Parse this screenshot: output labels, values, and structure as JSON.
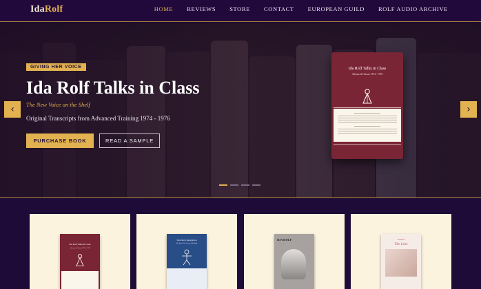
{
  "brand": {
    "first": "Ida",
    "second": "Rolf"
  },
  "nav": [
    {
      "label": "HOME",
      "active": true
    },
    {
      "label": "REVIEWS"
    },
    {
      "label": "STORE"
    },
    {
      "label": "CONTACT"
    },
    {
      "label": "EUROPEAN GUILD"
    },
    {
      "label": "ROLF AUDIO ARCHIVE"
    }
  ],
  "hero": {
    "badge": "GIVING HER VOICE",
    "title": "Ida Rolf Talks in Class",
    "subtitle": "The New Voice on the Shelf",
    "description": "Original Transcripts from Advanced Training 1974 - 1976",
    "primary_button": "PURCHASE BOOK",
    "secondary_button": "READ A SAMPLE",
    "prev_arrow": "‹",
    "next_arrow": "›",
    "book": {
      "title": "Ida Rolf Talks in Class",
      "subtitle": "Advanced Classes 1974 - 1976",
      "cover_color": "#7a2535"
    },
    "slide_count": 4,
    "active_slide": 1
  },
  "cards": [
    {
      "cover_title": "Ida Rolf Talks in Class",
      "cover_subtitle": "Advanced Classes 1974 - 1976",
      "cover_color": "#7a2535"
    },
    {
      "cover_title": "Structural Integration",
      "cover_subtitle": "My Book: The Heart of Rolfing",
      "cover_color": "#294d87"
    },
    {
      "cover_title": "IDA ROLF",
      "cover_subtitle": "",
      "cover_color": "#a7a29f"
    },
    {
      "cover_title": "Presents",
      "cover_subtitle": "The Line",
      "cover_color": "#f6ece7"
    }
  ],
  "colors": {
    "accent": "#e2b150",
    "background": "#1f0b37",
    "card": "#fcf3de"
  }
}
